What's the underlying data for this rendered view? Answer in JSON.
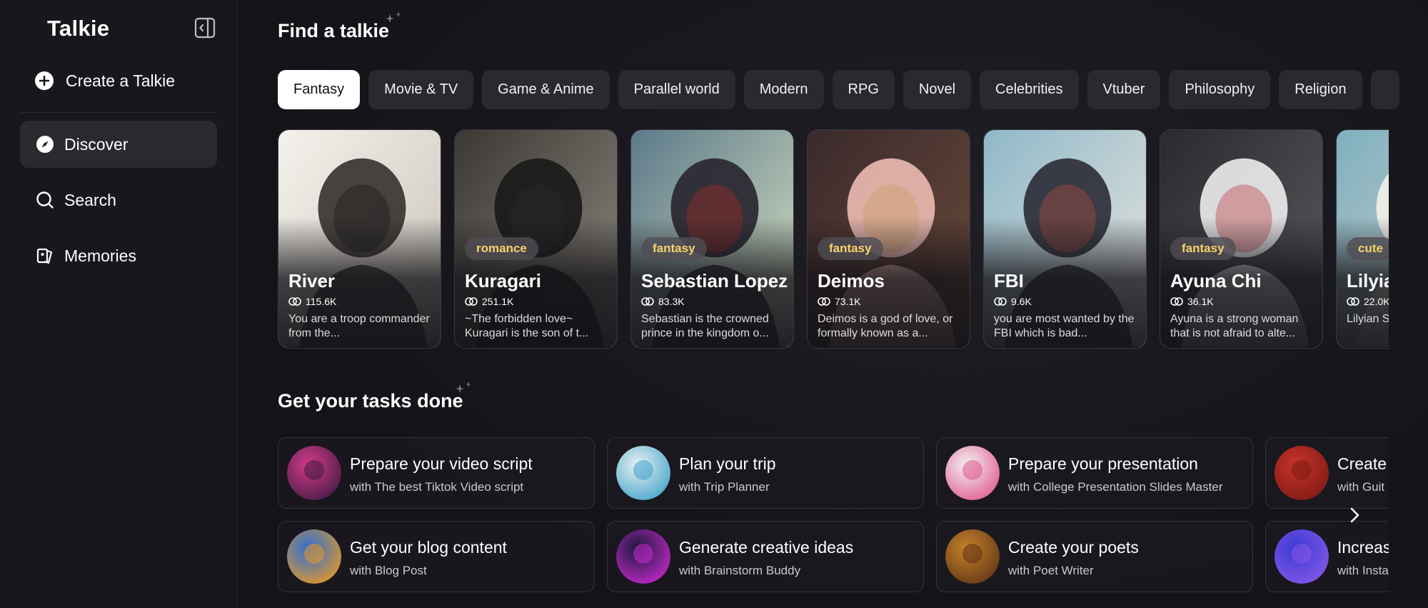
{
  "sidebar": {
    "logo": "Talkie",
    "create_label": "Create a Talkie",
    "nav": [
      {
        "label": "Discover",
        "icon": "compass-icon",
        "active": true
      },
      {
        "label": "Search",
        "icon": "search-icon",
        "active": false
      },
      {
        "label": "Memories",
        "icon": "memories-icon",
        "active": false
      }
    ]
  },
  "find_section": {
    "title": "Find a talkie",
    "tabs": [
      "Fantasy",
      "Movie & TV",
      "Game & Anime",
      "Parallel world",
      "Modern",
      "RPG",
      "Novel",
      "Celebrities",
      "Vtuber",
      "Philosophy",
      "Religion"
    ],
    "active_tab": "Fantasy"
  },
  "cards": [
    {
      "name": "River",
      "tag": "",
      "count": "115.6K",
      "desc": "You are a troop commander from the..."
    },
    {
      "name": "Kuragari",
      "tag": "romance",
      "count": "251.1K",
      "desc": "~The forbidden love~ Kuragari is the son of t..."
    },
    {
      "name": "Sebastian Lopez",
      "tag": "fantasy",
      "count": "83.3K",
      "desc": "Sebastian is the crowned prince in the kingdom o..."
    },
    {
      "name": "Deimos",
      "tag": "fantasy",
      "count": "73.1K",
      "desc": "Deimos is a god of love, or formally known as a..."
    },
    {
      "name": "FBI",
      "tag": "",
      "count": "9.6K",
      "desc": "you are most wanted by the FBI which is bad..."
    },
    {
      "name": "Ayuna Chi",
      "tag": "fantasy",
      "count": "36.1K",
      "desc": "Ayuna is a strong woman that is not afraid to alte..."
    },
    {
      "name": "Lilyian",
      "tag": "cute",
      "count": "22.0K",
      "desc": "Lilyian S... Duke of..."
    }
  ],
  "tasks_section": {
    "title": "Get your tasks done",
    "tasks": [
      {
        "title": "Prepare your video script",
        "sub": "with The best Tiktok Video script"
      },
      {
        "title": "Plan your trip",
        "sub": "with Trip Planner"
      },
      {
        "title": "Prepare your presentation",
        "sub": "with College Presentation Slides Master"
      },
      {
        "title": "Create",
        "sub": "with Guit"
      },
      {
        "title": "Get your blog content",
        "sub": "with Blog Post"
      },
      {
        "title": "Generate creative ideas",
        "sub": "with Brainstorm Buddy"
      },
      {
        "title": "Create your poets",
        "sub": "with Poet Writer"
      },
      {
        "title": "Increas",
        "sub": "with Insta"
      }
    ]
  },
  "colors": {
    "tag_text": "#f6d26a",
    "active_tab_bg": "#ffffff",
    "sidebar_bg": "#18171c"
  }
}
